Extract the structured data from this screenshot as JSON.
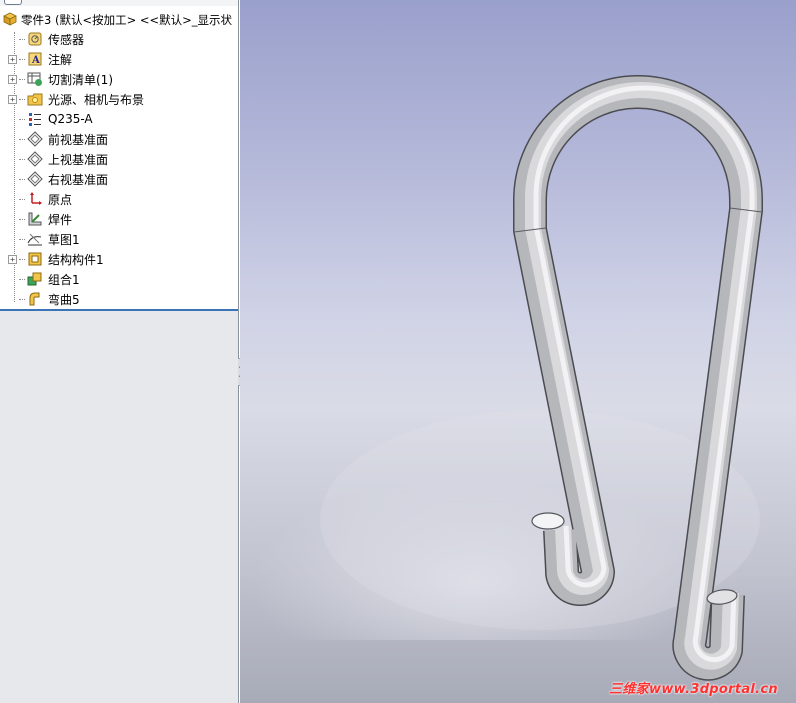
{
  "feature_tree": {
    "root_label": "零件3  (默认<按加工> <<默认>_显示状",
    "items": [
      {
        "label": "传感器",
        "icon": "sensor-icon",
        "expandable": false
      },
      {
        "label": "注解",
        "icon": "annotation-icon",
        "expandable": true
      },
      {
        "label": "切割清单(1)",
        "icon": "cut-list-icon",
        "expandable": true
      },
      {
        "label": "光源、相机与布景",
        "icon": "lights-cameras-scene-icon",
        "expandable": true
      },
      {
        "label": "Q235-A",
        "icon": "material-icon",
        "expandable": false
      },
      {
        "label": "前视基准面",
        "icon": "plane-icon",
        "expandable": false
      },
      {
        "label": "上视基准面",
        "icon": "plane-icon",
        "expandable": false
      },
      {
        "label": "右视基准面",
        "icon": "plane-icon",
        "expandable": false
      },
      {
        "label": "原点",
        "icon": "origin-icon",
        "expandable": false
      },
      {
        "label": "焊件",
        "icon": "weldment-icon",
        "expandable": false
      },
      {
        "label": "草图1",
        "icon": "sketch-icon",
        "expandable": false
      },
      {
        "label": "结构构件1",
        "icon": "structural-member-icon",
        "expandable": true
      },
      {
        "label": "组合1",
        "icon": "combine-icon",
        "expandable": false
      },
      {
        "label": "弯曲5",
        "icon": "flex-bend-icon",
        "expandable": false
      }
    ]
  },
  "viewport": {
    "model": "bent-tube-hook",
    "watermark": "三维家www.3dportal.cn"
  },
  "colors": {
    "tree_selection_line": "#3a73b8",
    "watermark": "#ff3030",
    "tube": "#c9c9cc"
  }
}
